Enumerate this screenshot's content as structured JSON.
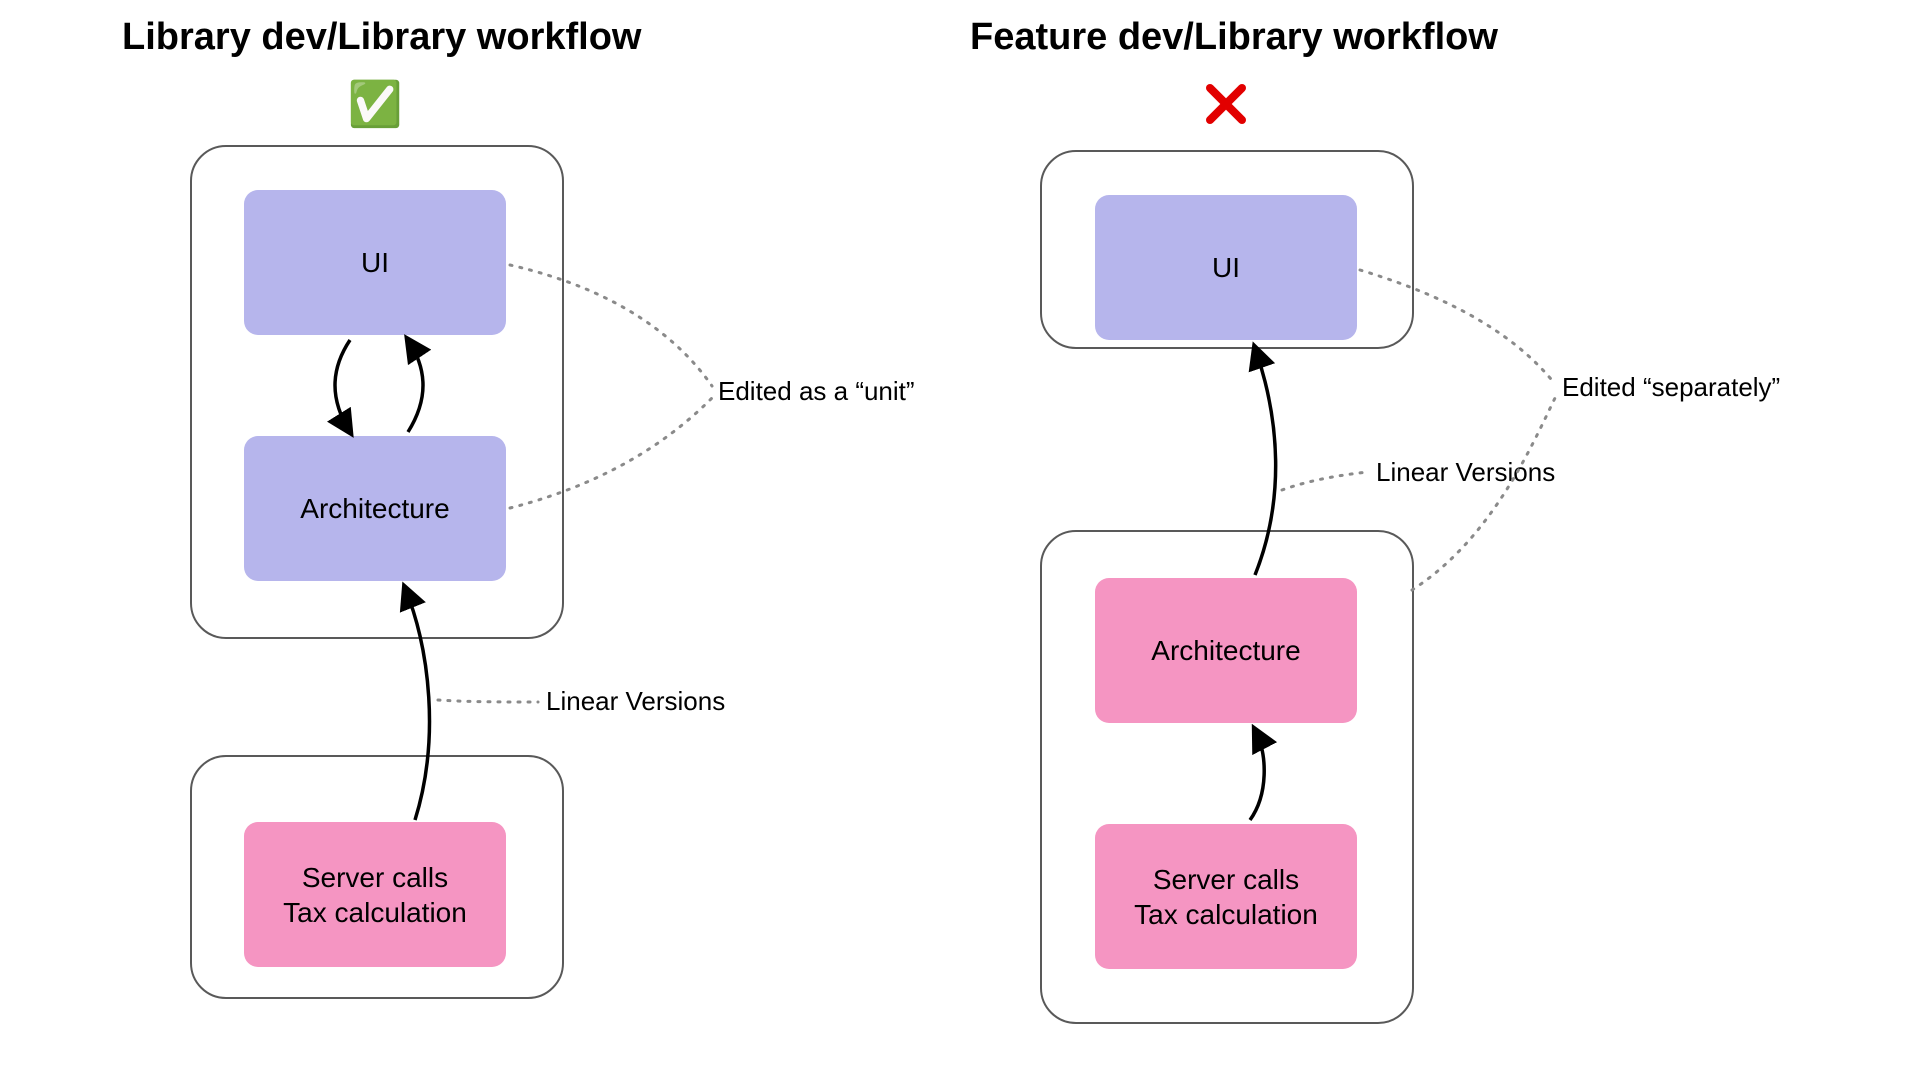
{
  "left": {
    "title": "Library dev/Library workflow",
    "status_icon": "✅",
    "nodes": {
      "ui": "UI",
      "arch": "Architecture",
      "server_l1": "Server calls",
      "server_l2": "Tax calculation"
    },
    "annotations": {
      "unit": "Edited as a “unit”",
      "linear": "Linear Versions"
    }
  },
  "right": {
    "title": "Feature dev/Library workflow",
    "nodes": {
      "ui": "UI",
      "arch": "Architecture",
      "server_l1": "Server calls",
      "server_l2": "Tax calculation"
    },
    "annotations": {
      "separate": "Edited “separately”",
      "linear": "Linear Versions"
    }
  },
  "colors": {
    "purple": "#b6b5ec",
    "pink": "#f595c2",
    "border": "#595959",
    "dot": "#8a8a8a",
    "arrow": "#000000",
    "red": "#e20000"
  }
}
